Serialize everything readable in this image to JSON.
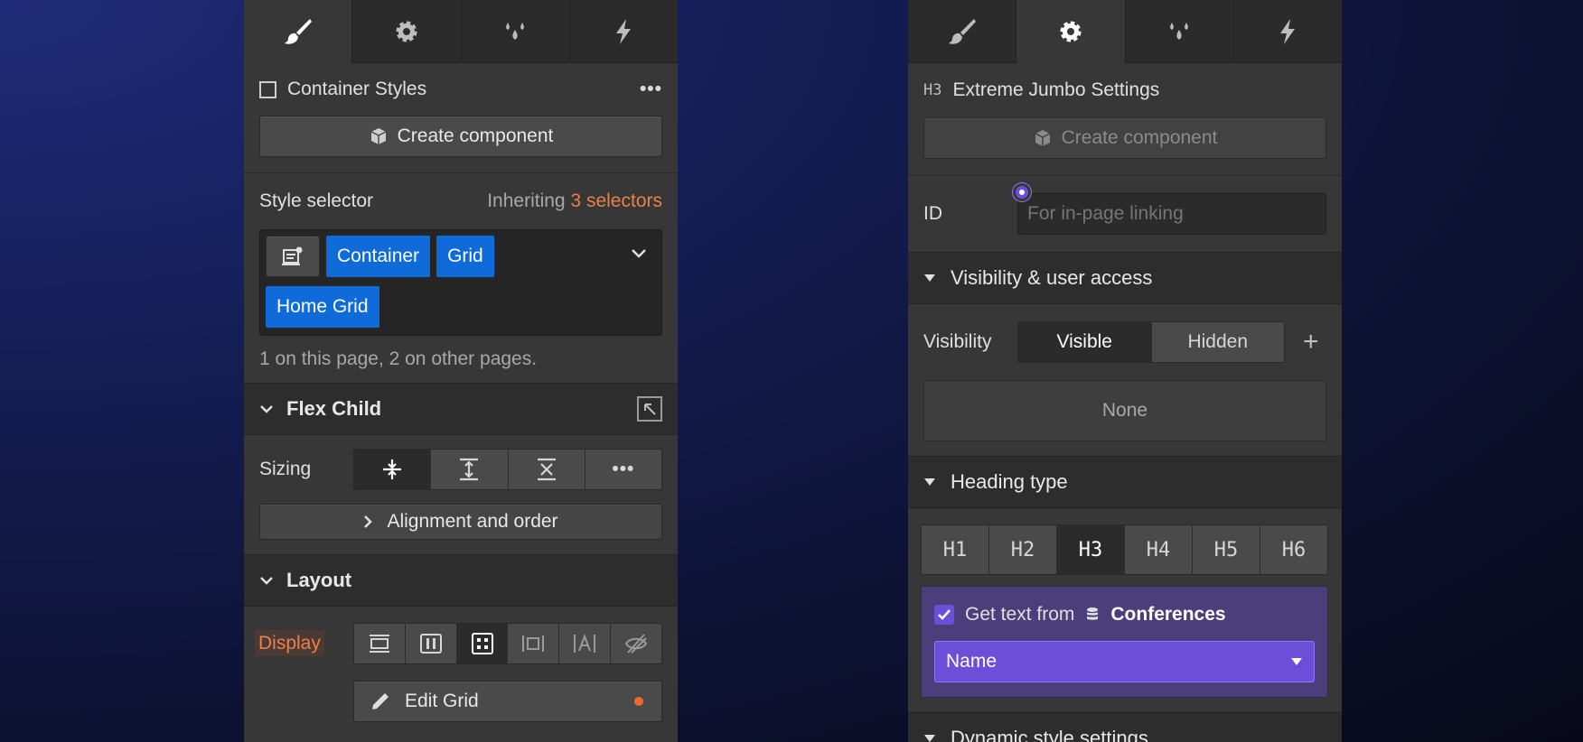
{
  "left": {
    "element_title": "Container Styles",
    "create_component": "Create component",
    "style_selector": {
      "label": "Style selector",
      "inheriting": "Inheriting",
      "selectors_link": "3 selectors",
      "chips": [
        "Container",
        "Grid",
        "Home Grid"
      ],
      "usage": "1 on this page, 2 on other pages."
    },
    "flex_child": {
      "title": "Flex Child",
      "sizing_label": "Sizing",
      "alignment": "Alignment and order"
    },
    "layout": {
      "title": "Layout",
      "display_label": "Display",
      "edit_grid": "Edit Grid"
    }
  },
  "right": {
    "tag_badge": "H3",
    "element_title": "Extreme Jumbo Settings",
    "create_component": "Create component",
    "id_label": "ID",
    "id_placeholder": "For in-page linking",
    "visibility_section": {
      "title": "Visibility & user access",
      "label": "Visibility",
      "visible": "Visible",
      "hidden": "Hidden",
      "none": "None"
    },
    "heading_section": {
      "title": "Heading type",
      "options": [
        "H1",
        "H2",
        "H3",
        "H4",
        "H5",
        "H6"
      ],
      "selected": "H3",
      "get_text_from": "Get text from",
      "collection": "Conferences",
      "field": "Name"
    },
    "next_section": "Dynamic style settings"
  },
  "colors": {
    "accent_orange": "#e8804a",
    "chip_blue": "#0f6bd9",
    "purple": "#6b4fd8",
    "purple_bg": "#4a3f7a",
    "dot_orange": "#f06a2a"
  }
}
